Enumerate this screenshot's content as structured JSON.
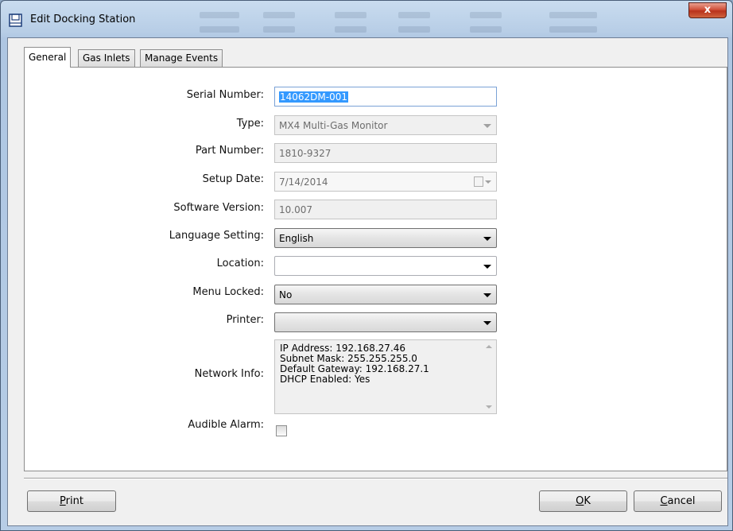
{
  "window": {
    "title": "Edit Docking Station",
    "close_label": "x"
  },
  "tabs": [
    {
      "label": "General",
      "active": true
    },
    {
      "label": "Gas Inlets",
      "active": false
    },
    {
      "label": "Manage Events",
      "active": false
    }
  ],
  "form": {
    "serial_number": {
      "label": "Serial Number:",
      "value": "14062DM-001"
    },
    "type": {
      "label": "Type:",
      "value": "MX4 Multi-Gas Monitor"
    },
    "part_number": {
      "label": "Part Number:",
      "value": "1810-9327"
    },
    "setup_date": {
      "label": "Setup Date:",
      "value": "7/14/2014"
    },
    "software_version": {
      "label": "Software Version:",
      "value": "10.007"
    },
    "language_setting": {
      "label": "Language Setting:",
      "value": "English"
    },
    "location": {
      "label": "Location:",
      "value": ""
    },
    "menu_locked": {
      "label": "Menu Locked:",
      "value": "No"
    },
    "printer": {
      "label": "Printer:",
      "value": ""
    },
    "network_info": {
      "label": "Network Info:",
      "lines": [
        "IP Address: 192.168.27.46",
        "Subnet Mask: 255.255.255.0",
        "Default Gateway: 192.168.27.1",
        "DHCP Enabled: Yes"
      ]
    },
    "audible_alarm": {
      "label": "Audible Alarm:",
      "checked": false
    }
  },
  "buttons": {
    "print": {
      "mnemonic": "P",
      "rest": "rint"
    },
    "ok": {
      "mnemonic": "O",
      "rest": "K"
    },
    "cancel": {
      "mnemonic": "C",
      "rest": "ancel"
    }
  },
  "colors": {
    "selection": "#3399ff",
    "frame": "#b7cde6",
    "close": "#c9432b"
  }
}
